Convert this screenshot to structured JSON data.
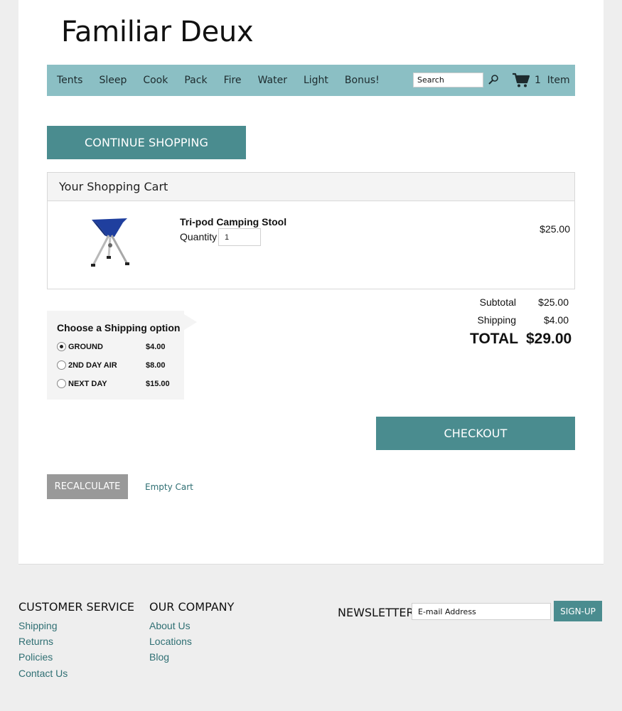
{
  "site": {
    "title": "Familiar Deux"
  },
  "nav": {
    "items": [
      {
        "label": "Tents"
      },
      {
        "label": "Sleep"
      },
      {
        "label": "Cook"
      },
      {
        "label": "Pack"
      },
      {
        "label": "Fire"
      },
      {
        "label": "Water"
      },
      {
        "label": "Light"
      },
      {
        "label": "Bonus!"
      }
    ],
    "search_placeholder": "Search",
    "search_icon": "search-icon",
    "cart_icon": "cart-icon",
    "cart_count": "1  Item"
  },
  "buttons": {
    "continue_shopping": "CONTINUE SHOPPING",
    "checkout": "CHECKOUT",
    "recalculate": "RECALCULATE",
    "empty_cart": "Empty Cart"
  },
  "cart": {
    "heading": "Your Shopping Cart",
    "items": [
      {
        "name": "Tri-pod Camping Stool",
        "quantity_label": "Quantity",
        "quantity": "1",
        "price": "$25.00"
      }
    ]
  },
  "shipping": {
    "title": "Choose a Shipping option",
    "options": [
      {
        "label": "GROUND",
        "price": "$4.00",
        "selected": true
      },
      {
        "label": "2ND DAY AIR",
        "price": "$8.00",
        "selected": false
      },
      {
        "label": "NEXT DAY",
        "price": "$15.00",
        "selected": false
      }
    ]
  },
  "summary": {
    "subtotal_label": "Subtotal",
    "subtotal_value": "$25.00",
    "shipping_label": "Shipping",
    "shipping_value": "$4.00",
    "total_label": "TOTAL",
    "total_value": "$29.00"
  },
  "footer": {
    "customer_service": {
      "heading": "CUSTOMER SERVICE",
      "links": [
        "Shipping",
        "Returns",
        "Policies",
        "Contact Us"
      ]
    },
    "our_company": {
      "heading": "OUR COMPANY",
      "links": [
        "About Us",
        "Locations",
        "Blog"
      ]
    },
    "newsletter": {
      "heading": "NEWSLETTER",
      "placeholder": "E-mail Address",
      "button": "SIGN-UP"
    }
  },
  "colors": {
    "nav_bg": "#8bbfc4",
    "accent": "#4a8c8f",
    "link": "#2f6f73",
    "secondary_button": "#999999"
  }
}
